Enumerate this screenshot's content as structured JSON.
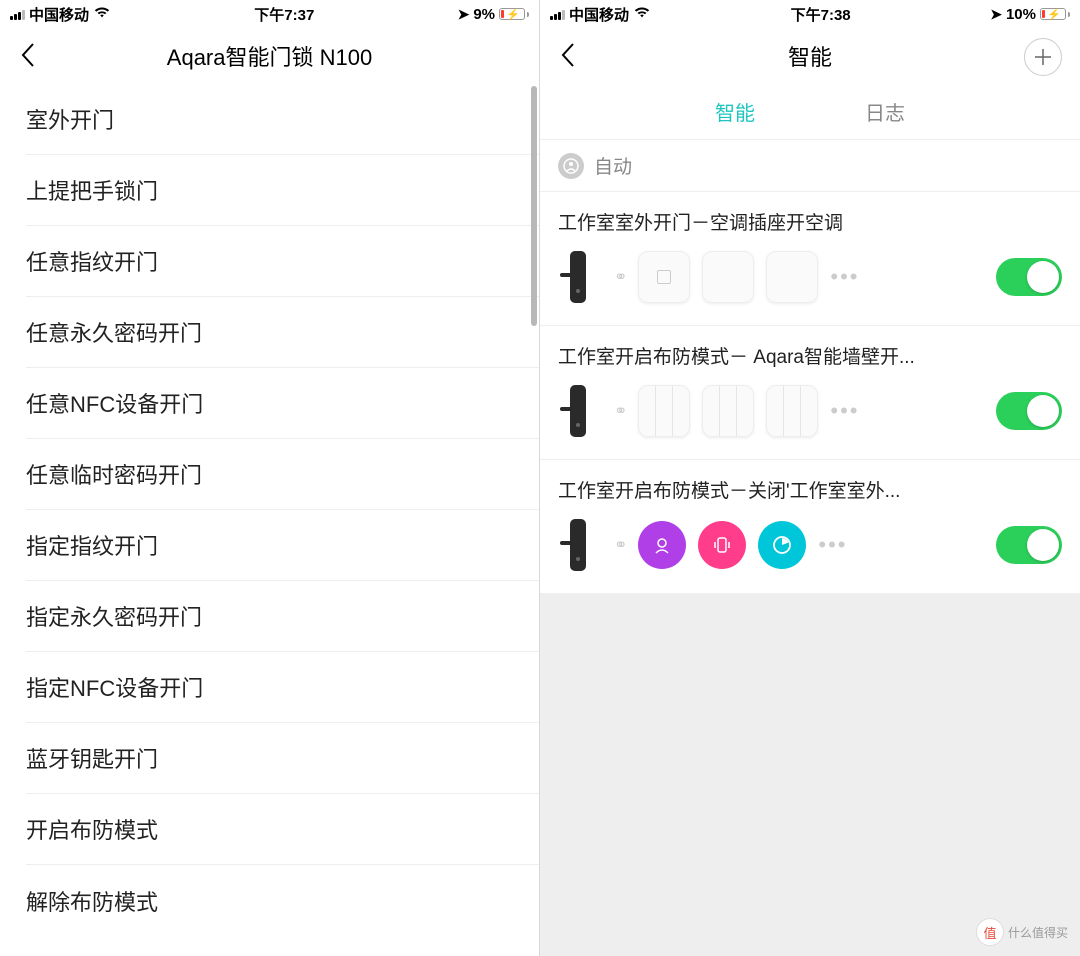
{
  "left": {
    "status": {
      "carrier": "中国移动",
      "time": "下午7:37",
      "battery": "9%"
    },
    "nav_title": "Aqara智能门锁 N100",
    "items": [
      "室外开门",
      "上提把手锁门",
      "任意指纹开门",
      "任意永久密码开门",
      "任意NFC设备开门",
      "任意临时密码开门",
      "指定指纹开门",
      "指定永久密码开门",
      "指定NFC设备开门",
      "蓝牙钥匙开门",
      "开启布防模式",
      "解除布防模式"
    ]
  },
  "right": {
    "status": {
      "carrier": "中国移动",
      "time": "下午7:38",
      "battery": "10%"
    },
    "nav_title": "智能",
    "tabs": {
      "active": "智能",
      "inactive": "日志"
    },
    "section": "自动",
    "automations": [
      {
        "title": "工作室室外开门－空调插座开空调",
        "enabled": true,
        "devices": [
          "lock",
          "link",
          "outlet",
          "wall",
          "wall",
          "dots"
        ]
      },
      {
        "title": "工作室开启布防模式－ Aqara智能墙壁开...",
        "enabled": true,
        "devices": [
          "lock",
          "link",
          "wall3",
          "wall3",
          "wall3",
          "dots"
        ]
      },
      {
        "title": "工作室开启布防模式－关闭'工作室室外...",
        "enabled": true,
        "devices": [
          "lock",
          "link",
          "purple",
          "pink",
          "cyan",
          "dots"
        ]
      }
    ]
  },
  "watermark": {
    "char": "值",
    "text": "什么值得买"
  }
}
